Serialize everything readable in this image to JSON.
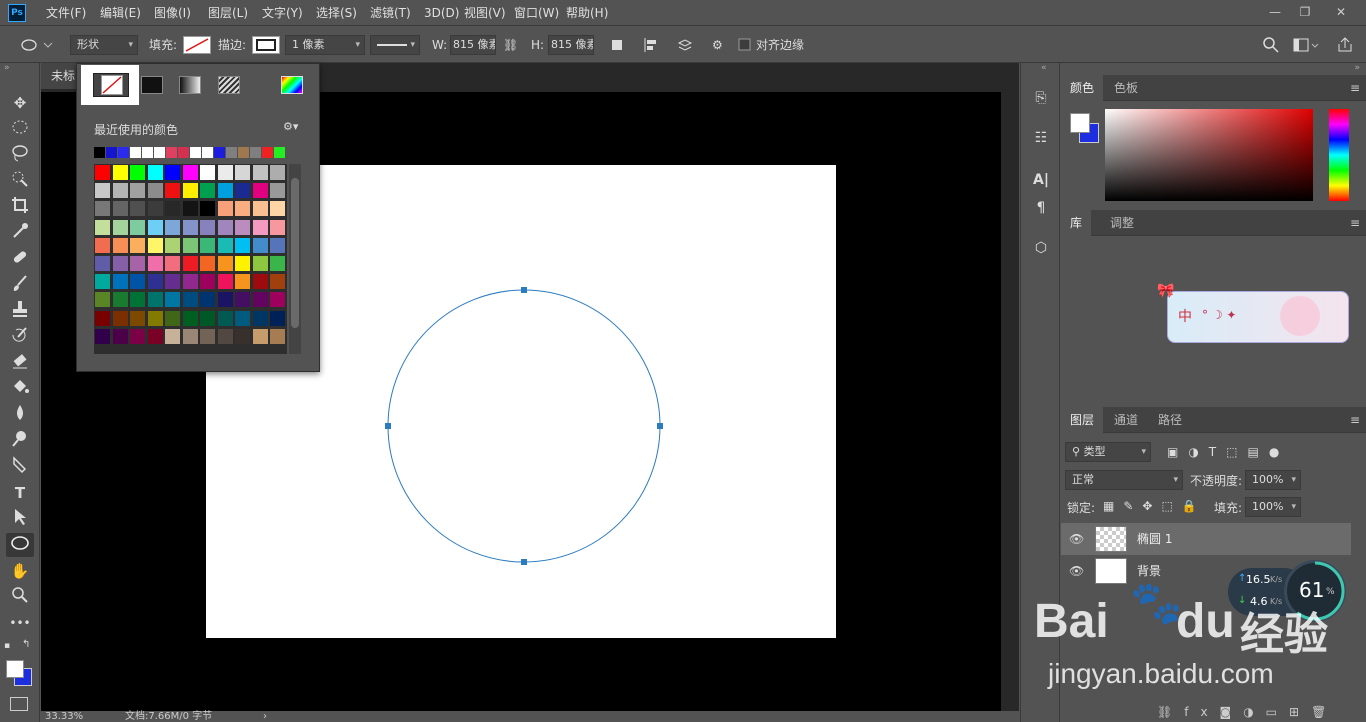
{
  "app": {
    "logo": "Ps"
  },
  "menu": [
    "文件(F)",
    "编辑(E)",
    "图像(I)",
    "图层(L)",
    "文字(Y)",
    "选择(S)",
    "滤镜(T)",
    "3D(D)",
    "视图(V)",
    "窗口(W)",
    "帮助(H)"
  ],
  "window_buttons": {
    "minimize": "—",
    "restore": "❐",
    "close": "✕"
  },
  "options": {
    "mode": "形状",
    "fill_label": "填充:",
    "stroke_label": "描边:",
    "stroke_width": "1 像素",
    "w_label": "W:",
    "w_value": "815 像素",
    "h_label": "H:",
    "h_value": "815 像素",
    "align_edges": "对齐边缘"
  },
  "document": {
    "tab": "未标",
    "zoom": "33.33%",
    "doc_info": "文档:7.66M/0 字节"
  },
  "fill_popup": {
    "recent_label": "最近使用的颜色",
    "recent": [
      "#000000",
      "#1515d0",
      "#2b2bf0",
      "#ffffff",
      "#ffffff",
      "#ffffff",
      "#e04060",
      "#d43050",
      "#ffffff",
      "#ffffff",
      "#1d1ddf",
      "#7f7f7f",
      "#a07850",
      "#7f7f7f",
      "#ee2222",
      "#22ee22"
    ],
    "swatches": [
      [
        "#ff0000",
        "#ffff00",
        "#00ff00",
        "#00ffff",
        "#0000ff",
        "#ff00ff",
        "#ffffff",
        "#ebebeb",
        "#d6d6d6",
        "#c2c2c2",
        "#adadad"
      ],
      [
        "#c8c8c8",
        "#b4b4b4",
        "#a0a0a0",
        "#8c8c8c",
        "#ee1111",
        "#ffee00",
        "#00a050",
        "#00a0e0",
        "#1a2a90",
        "#e00080",
        "#999999"
      ],
      [
        "#787878",
        "#646464",
        "#505050",
        "#3c3c3c",
        "#282828",
        "#141414",
        "#000000",
        "#f7a07a",
        "#f9ad81",
        "#fbc091",
        "#fdd5a6"
      ],
      [
        "#c4df9b",
        "#a3d49c",
        "#7dcb9e",
        "#6dcff6",
        "#7da7d9",
        "#8393ca",
        "#8781bd",
        "#a186be",
        "#bd8cbf",
        "#f49ac1",
        "#f6989d"
      ],
      [
        "#f26c4f",
        "#f68e56",
        "#fbaf5d",
        "#fff568",
        "#acd372",
        "#7cc576",
        "#3bb878",
        "#1abbb4",
        "#00bff3",
        "#438ccb",
        "#5574b9"
      ],
      [
        "#605ca8",
        "#855fa8",
        "#a763a8",
        "#f06eaa",
        "#f26d7d",
        "#ed1c24",
        "#f26522",
        "#f7941d",
        "#fff200",
        "#8dc73f",
        "#39b54a"
      ],
      [
        "#00a99d",
        "#0072bc",
        "#0054a6",
        "#2e3192",
        "#662d91",
        "#92278f",
        "#9e005d",
        "#ed145b",
        "#f7941d",
        "#9e0b0f",
        "#a0410d"
      ],
      [
        "#598527",
        "#197b30",
        "#007236",
        "#00746b",
        "#0076a3",
        "#004b80",
        "#003471",
        "#1b1464",
        "#440e62",
        "#630460",
        "#9e005d"
      ],
      [
        "#790000",
        "#7b2e00",
        "#7d4900",
        "#827b00",
        "#406618",
        "#005e20",
        "#005826",
        "#005952",
        "#005b7f",
        "#003663",
        "#002157"
      ],
      [
        "#32004b",
        "#4b0049",
        "#7b0046",
        "#7a0026",
        "#c7b299",
        "#998675",
        "#736357",
        "#534741",
        "#37302d",
        "#c69c6d",
        "#a67c52"
      ]
    ]
  },
  "panels": {
    "color_tabs": [
      "颜色",
      "色板"
    ],
    "library_tabs": [
      "库",
      "调整"
    ],
    "library_banner_text": "中",
    "layers_tabs": [
      "图层",
      "通道",
      "路径"
    ],
    "filter_kind": "类型",
    "blend_mode": "正常",
    "opacity_label": "不透明度:",
    "opacity": "100%",
    "lock_label": "锁定:",
    "fill_label": "填充:",
    "fill": "100%",
    "layers": [
      {
        "name": "椭圆 1"
      },
      {
        "name": "背景"
      }
    ]
  },
  "network": {
    "up": "16.5",
    "up_unit": "K/s",
    "down": "4.6",
    "down_unit": "K/s",
    "percent": "61",
    "percent_unit": "%"
  },
  "watermark": {
    "brand": "Bai",
    "brand2": "du",
    "cn": "经验",
    "url": "jingyan.baidu.com"
  }
}
